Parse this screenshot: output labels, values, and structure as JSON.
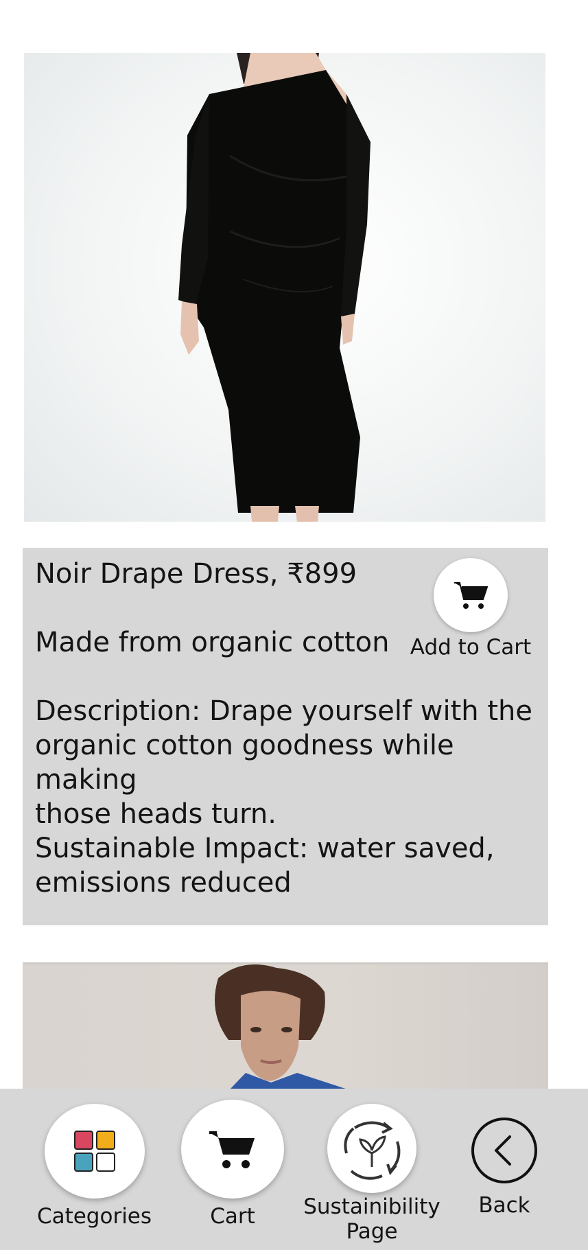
{
  "product": {
    "title_price": "Noir Drape Dress, ₹899",
    "material": "Made from organic cotton",
    "description": "Description: Drape yourself with the\norganic cotton goodness while making\nthose heads turn.",
    "impact": "Sustainable Impact: water saved,\nemissions reduced",
    "add_to_cart_label": "Add to Cart"
  },
  "bottom_nav": {
    "categories_label": "Categories",
    "cart_label": "Cart",
    "sustainability_label": "Sustainibility\nPage",
    "back_label": "Back"
  },
  "colors": {
    "card_bg": "#d7d7d7",
    "icon_red": "#d9465f",
    "icon_yellow": "#f2ad1b",
    "icon_teal": "#4aa3bc"
  }
}
